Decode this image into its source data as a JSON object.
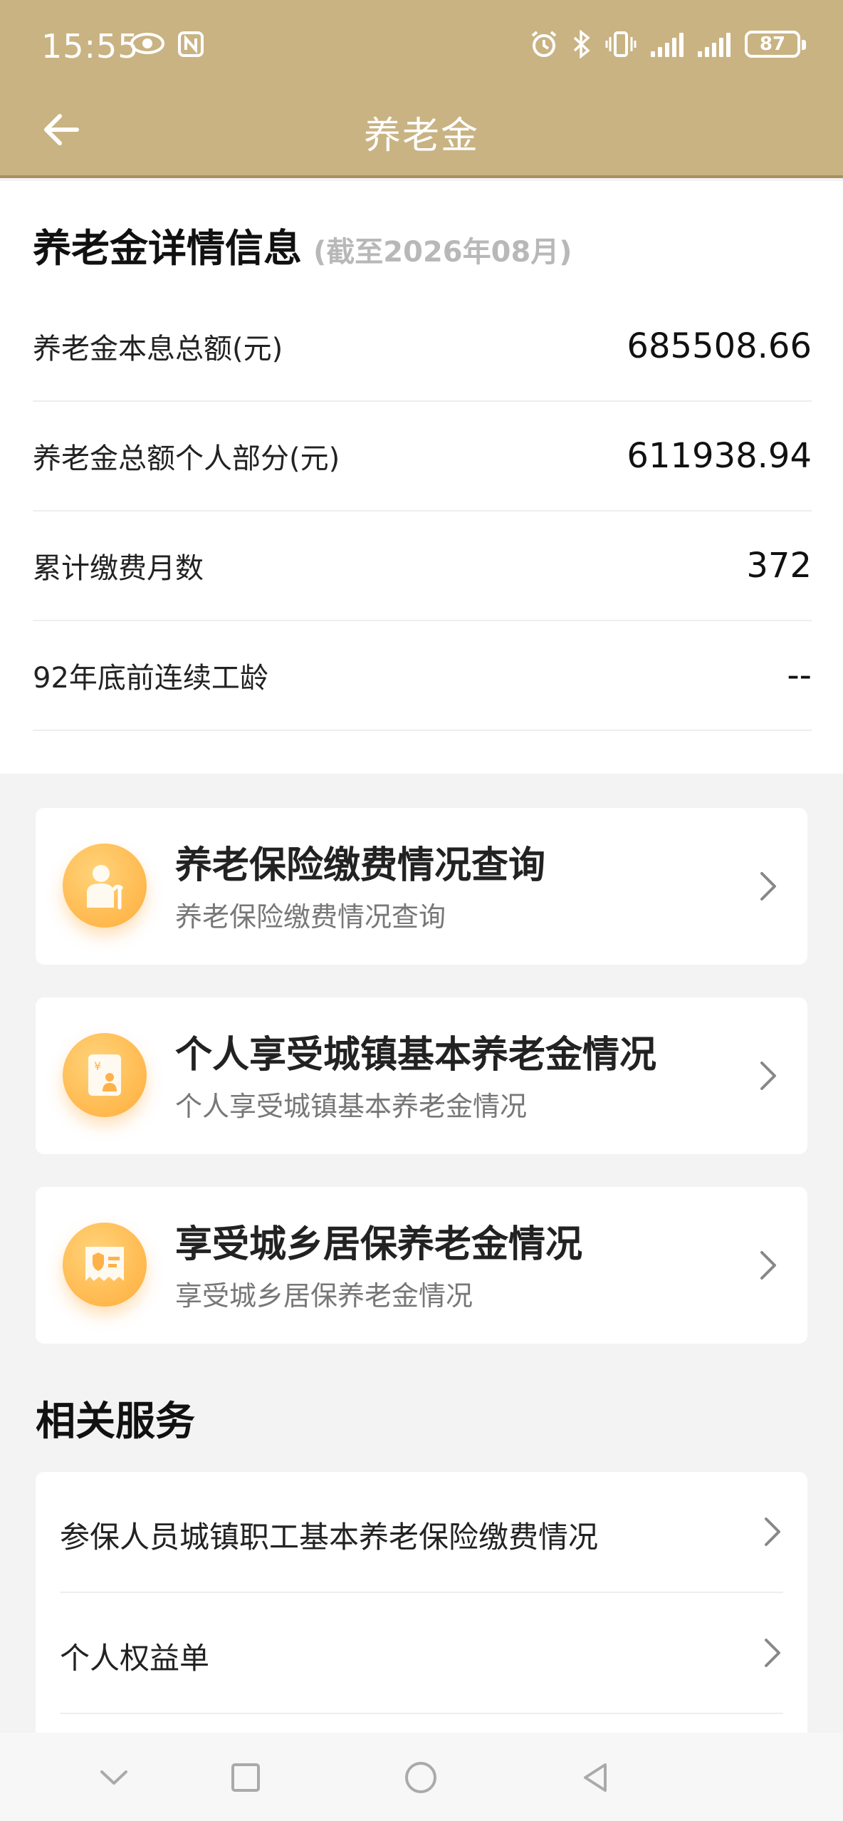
{
  "status_bar": {
    "time": "15:55",
    "battery": "87",
    "icons": [
      "eye-icon",
      "nfc-icon",
      "alarm-icon",
      "bluetooth-icon",
      "vibrate-icon",
      "signal-icon",
      "signal-icon",
      "battery-icon"
    ]
  },
  "nav": {
    "title": "养老金",
    "back_icon": "arrow-left-icon"
  },
  "details": {
    "title": "养老金详情信息",
    "subtitle": "(截至2026年08月)",
    "rows": [
      {
        "label": "养老金本息总额(元)",
        "value": "685508.66"
      },
      {
        "label": "养老金总额个人部分(元)",
        "value": "611938.94"
      },
      {
        "label": "累计缴费月数",
        "value": "372"
      },
      {
        "label": "92年底前连续工龄",
        "value": "--"
      }
    ]
  },
  "cards": [
    {
      "title": "养老保险缴费情况查询",
      "subtitle": "养老保险缴费情况查询",
      "icon": "elder-person-icon"
    },
    {
      "title": "个人享受城镇基本养老金情况",
      "subtitle": "个人享受城镇基本养老金情况",
      "icon": "pension-card-icon"
    },
    {
      "title": "享受城乡居保养老金情况",
      "subtitle": "享受城乡居保养老金情况",
      "icon": "insurance-receipt-icon"
    }
  ],
  "related": {
    "title": "相关服务",
    "items": [
      {
        "label": "参保人员城镇职工基本养老保险缴费情况"
      },
      {
        "label": "个人权益单"
      }
    ]
  },
  "colors": {
    "header": "#c9b383",
    "accent_orange": "#ffad3b"
  }
}
